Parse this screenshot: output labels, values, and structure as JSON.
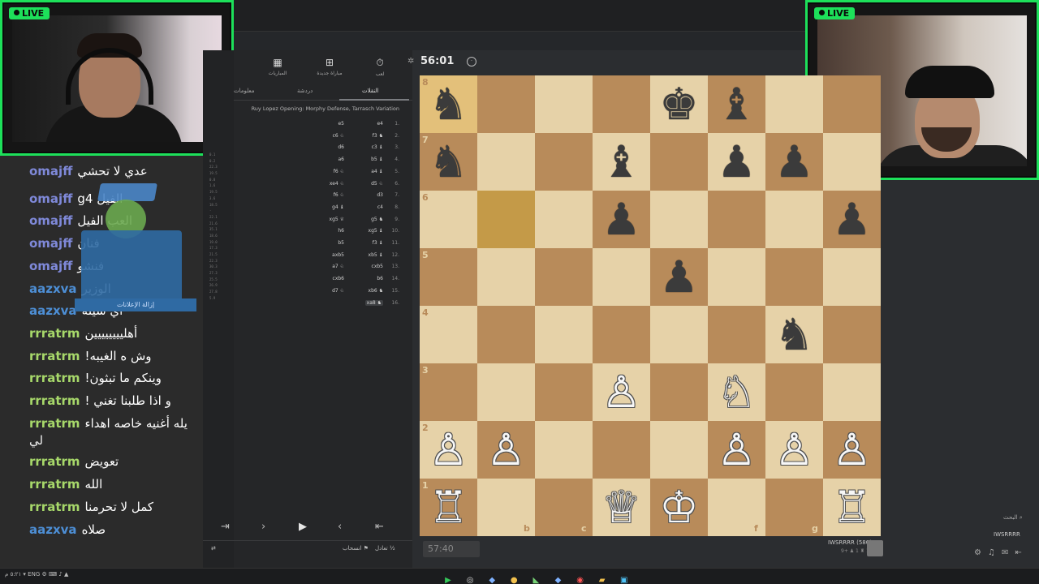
{
  "webcams": {
    "left_badge": "LIVE",
    "right_badge": "LIVE"
  },
  "chat": {
    "messages": [
      {
        "user": "omajff",
        "text": "عدي لا تحشي",
        "color": "#7f89d9",
        "partial": true
      },
      {
        "user": "omajff",
        "text": "g4 الفيل",
        "color": "#7f89d9"
      },
      {
        "user": "omajff",
        "text": "العب الفيل",
        "color": "#7f89d9"
      },
      {
        "user": "omajff",
        "text": "فنان",
        "color": "#7f89d9"
      },
      {
        "user": "omajff",
        "text": "فنشو",
        "color": "#7f89d9"
      },
      {
        "user": "aazxva",
        "text": "الوزير",
        "color": "#4d8fd6"
      },
      {
        "user": "aazxva",
        "text": "اي شيله",
        "color": "#4d8fd6"
      },
      {
        "user": "rrratrm",
        "text": "أهليييييييين",
        "color": "#a7d86a"
      },
      {
        "user": "rrratrm",
        "text": "!وش ه الغيبه",
        "color": "#a7d86a"
      },
      {
        "user": "rrratrm",
        "text": "!وينكم ما تبثون",
        "color": "#a7d86a"
      },
      {
        "user": "rrratrm",
        "text": "! و اذا طلبنا تغني",
        "color": "#a7d86a"
      },
      {
        "user": "rrratrm",
        "text": "يله أغنيه خاصه اهداء",
        "color": "#a7d86a",
        "continuation": "لي"
      },
      {
        "user": "rrratrm",
        "text": "تعويض",
        "color": "#a7d86a"
      },
      {
        "user": "rrratrm",
        "text": "الله",
        "color": "#a7d86a"
      },
      {
        "user": "rrratrm",
        "text": "كمل لا تحرمنا",
        "color": "#a7d86a"
      },
      {
        "user": "aazxva",
        "text": "صلاه",
        "color": "#4d8fd6"
      }
    ],
    "mascot_label": "إزالة الإعلانات"
  },
  "panel": {
    "tabs": [
      {
        "label": "المباريات",
        "icon": "chessboard-icon"
      },
      {
        "label": "مباراة جديدة",
        "icon": "plus-icon"
      },
      {
        "label": "لعب",
        "icon": "stopwatch-icon"
      }
    ],
    "subtabs": {
      "moves": "النقلات",
      "chat": "دردشة",
      "info": "معلومات"
    },
    "opening": "Ruy Lopez Opening: Morphy Defense, Tarrasch Variation",
    "moves": [
      {
        "num": "1.",
        "white": "e4",
        "black": "e5"
      },
      {
        "num": "2.",
        "white": "f3 ♞",
        "black": "c6 ♘"
      },
      {
        "num": "3.",
        "white": "c3 ♝",
        "black": "d6"
      },
      {
        "num": "4.",
        "white": "b5 ♝",
        "black": "a6"
      },
      {
        "num": "5.",
        "white": "a4 ♝",
        "black": "f6 ♘"
      },
      {
        "num": "6.",
        "white": "d5 ♘",
        "black": "xe4 ♘"
      },
      {
        "num": "7.",
        "white": "d3",
        "black": "f6 ♘"
      },
      {
        "num": "8.",
        "white": "c4",
        "black": "g4 ♝"
      },
      {
        "num": "9.",
        "white": "g5 ♞",
        "black": "xg5 ♕"
      },
      {
        "num": "10.",
        "white": "xg5 ♝",
        "black": "h6"
      },
      {
        "num": "11.",
        "white": "f3 ♝",
        "black": "b5"
      },
      {
        "num": "12.",
        "white": "xb5 ♝",
        "black": "axb5"
      },
      {
        "num": "13.",
        "white": "cxb5",
        "black": "a7 ♘"
      },
      {
        "num": "14.",
        "white": "b6",
        "black": "cxb6"
      },
      {
        "num": "15.",
        "white": "xb6 ♞",
        "black": "d7 ♘"
      },
      {
        "num": "16.",
        "white": "xa8 ♞",
        "black": ""
      }
    ],
    "eval_values": [
      "0.1",
      "0.2",
      "22.3",
      "19.5",
      "0.8",
      "1.6",
      "19.5",
      "3.6",
      "18.5",
      "-",
      "22.1",
      "21.6",
      "35.1",
      "18.6",
      "19.0",
      "17.3",
      "21.5",
      "22.3",
      "30.3",
      "27.3",
      "25.5",
      "26.9",
      "27.8",
      "5.9"
    ],
    "footer": {
      "draw": "تعادل",
      "draw_glyph": "½",
      "resign": "انسحاب"
    }
  },
  "game": {
    "clock_top": "56:01",
    "clock_bottom": "57:40",
    "player_bottom": "IWSRRRR (580)",
    "player_meta": "9+ ♟ 1 ♜ 111"
  },
  "board": {
    "pieces": [
      {
        "sq": "a8",
        "p": "♞",
        "c": "b"
      },
      {
        "sq": "e8",
        "p": "♚",
        "c": "b"
      },
      {
        "sq": "f8",
        "p": "♝",
        "c": "b"
      },
      {
        "sq": "a7",
        "p": "♞",
        "c": "b"
      },
      {
        "sq": "d7",
        "p": "♝",
        "c": "b"
      },
      {
        "sq": "f7",
        "p": "♟",
        "c": "b"
      },
      {
        "sq": "g7",
        "p": "♟",
        "c": "b"
      },
      {
        "sq": "d6",
        "p": "♟",
        "c": "b"
      },
      {
        "sq": "h6",
        "p": "♟",
        "c": "b"
      },
      {
        "sq": "e5",
        "p": "♟",
        "c": "b"
      },
      {
        "sq": "g4",
        "p": "♞",
        "c": "b"
      },
      {
        "sq": "d3",
        "p": "♙",
        "c": "w"
      },
      {
        "sq": "f3",
        "p": "♘",
        "c": "w"
      },
      {
        "sq": "a2",
        "p": "♙",
        "c": "w"
      },
      {
        "sq": "b2",
        "p": "♙",
        "c": "w"
      },
      {
        "sq": "f2",
        "p": "♙",
        "c": "w"
      },
      {
        "sq": "g2",
        "p": "♙",
        "c": "w"
      },
      {
        "sq": "h2",
        "p": "♙",
        "c": "w"
      },
      {
        "sq": "a1",
        "p": "♖",
        "c": "w"
      },
      {
        "sq": "d1",
        "p": "♕",
        "c": "w"
      },
      {
        "sq": "e1",
        "p": "♔",
        "c": "w"
      },
      {
        "sq": "h1",
        "p": "♖",
        "c": "w"
      }
    ],
    "highlights": [
      "a8",
      "b6"
    ],
    "ranks": [
      "8",
      "7",
      "6",
      "5",
      "4",
      "3",
      "2",
      "1"
    ],
    "files": [
      "a",
      "b",
      "c",
      "d",
      "e",
      "f",
      "g",
      "h"
    ],
    "files_visible": [
      "b",
      "c",
      "f",
      "g"
    ]
  },
  "right_sidebar": {
    "search_label": "البحث",
    "user": "IWSRRRR"
  },
  "taskbar": {
    "left_text": "ENG",
    "time_text": "٥:٢١ م"
  }
}
